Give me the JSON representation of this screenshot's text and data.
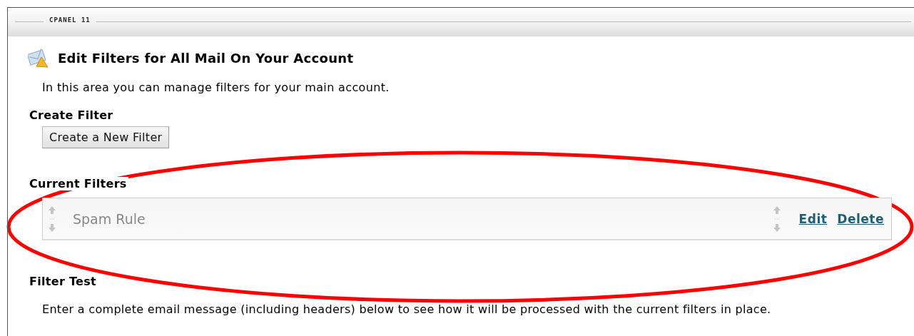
{
  "panel": {
    "label": "CPANEL 11"
  },
  "title": "Edit Filters for All Mail On Your Account",
  "description": "In this area you can manage filters for your main account.",
  "create_filter": {
    "heading": "Create Filter",
    "button": "Create a New Filter"
  },
  "current_filters": {
    "heading": "Current Filters",
    "filters": [
      {
        "name": "Spam Rule",
        "actions": [
          "Edit",
          "Delete"
        ]
      }
    ]
  },
  "filter_test": {
    "heading": "Filter Test",
    "description": "Enter a complete email message (including headers) below to see how it will be processed with the current filters in place."
  }
}
